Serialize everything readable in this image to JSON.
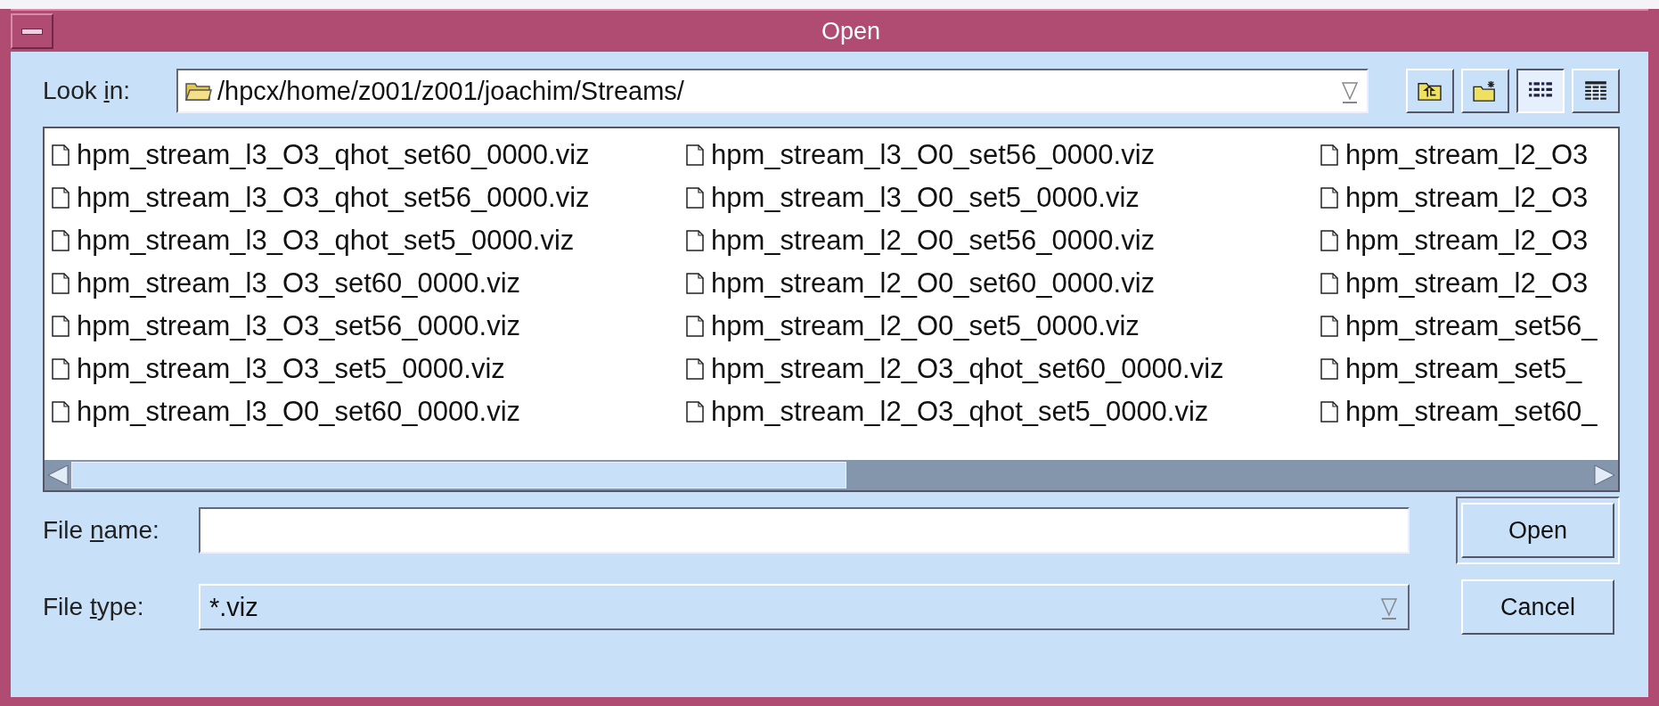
{
  "window": {
    "title": "Open"
  },
  "look_in": {
    "label_parts": [
      "Look ",
      "i",
      "n:"
    ],
    "path": "/hpcx/home/z001/z001/joachim/Streams/"
  },
  "toolbar": [
    {
      "kind": "up",
      "selected": false
    },
    {
      "kind": "new_folder",
      "selected": false
    },
    {
      "kind": "list",
      "selected": true
    },
    {
      "kind": "details",
      "selected": false
    }
  ],
  "files": {
    "columns": [
      [
        "hpm_stream_l3_O3_qhot_set60_0000.viz",
        "hpm_stream_l3_O3_qhot_set56_0000.viz",
        "hpm_stream_l3_O3_qhot_set5_0000.viz",
        "hpm_stream_l3_O3_set60_0000.viz",
        "hpm_stream_l3_O3_set56_0000.viz",
        "hpm_stream_l3_O3_set5_0000.viz",
        "hpm_stream_l3_O0_set60_0000.viz"
      ],
      [
        "hpm_stream_l3_O0_set56_0000.viz",
        "hpm_stream_l3_O0_set5_0000.viz",
        "hpm_stream_l2_O0_set56_0000.viz",
        "hpm_stream_l2_O0_set60_0000.viz",
        "hpm_stream_l2_O0_set5_0000.viz",
        "hpm_stream_l2_O3_qhot_set60_0000.viz",
        "hpm_stream_l2_O3_qhot_set5_0000.viz"
      ],
      [
        "hpm_stream_l2_O3",
        "hpm_stream_l2_O3",
        "hpm_stream_l2_O3",
        "hpm_stream_l2_O3",
        "hpm_stream_set56_",
        "hpm_stream_set5_",
        "hpm_stream_set60_"
      ]
    ]
  },
  "file_name": {
    "label_parts": [
      "File ",
      "n",
      "ame:"
    ]
  },
  "file_type": {
    "label_parts": [
      "File ",
      "t",
      "ype:"
    ],
    "value": "*.viz"
  },
  "buttons": [
    {
      "label": "Open",
      "default": true
    },
    {
      "label": "Cancel",
      "default": false
    }
  ]
}
